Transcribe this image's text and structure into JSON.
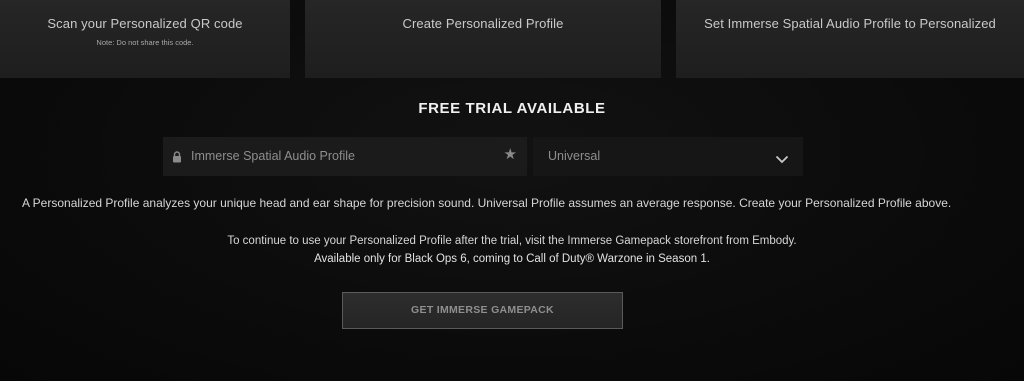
{
  "steps": [
    {
      "title": "Scan your Personalized QR code",
      "note": "Note: Do not share this code."
    },
    {
      "title": "Create Personalized Profile"
    },
    {
      "title": "Set Immerse Spatial Audio Profile to Personalized"
    }
  ],
  "trial": {
    "heading": "FREE TRIAL AVAILABLE"
  },
  "profile_field": {
    "label": "Immerse Spatial Audio Profile",
    "icon": "lock-icon",
    "star": "★",
    "star_icon": "star-icon"
  },
  "universal_select": {
    "selected": "Universal",
    "icon": "chevron-down-icon"
  },
  "info": {
    "description": "A Personalized Profile analyzes your unique head and ear shape for precision sound. Universal Profile assumes an average response. Create your Personalized Profile above.",
    "continue_text": "To continue to use your Personalized Profile after the trial, visit the Immerse Gamepack storefront from Embody.",
    "availability_text": "Available only for Black Ops 6, coming to Call of Duty® Warzone in Season 1."
  },
  "cta": {
    "label": "GET IMMERSE GAMEPACK"
  },
  "colors": {
    "background": "#0a0a0a",
    "card": "#232323",
    "field": "#1b1b1b",
    "text": "#d6d6d6",
    "muted": "#8e8e8e"
  }
}
